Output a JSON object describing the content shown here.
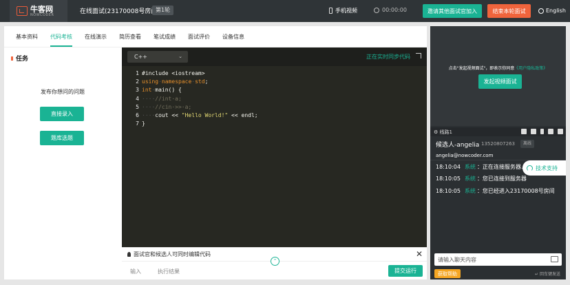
{
  "app": {
    "logo_cn": "牛客网",
    "logo_en": "NOWCODER",
    "room_title": "在线面试(23170008号房间)",
    "round": "第1轮"
  },
  "header": {
    "phone_video": "手机视频",
    "timer": "00:00:00",
    "invite_button": "邀请其他面试官加入",
    "end_button": "结束本轮面试",
    "language": "English"
  },
  "tabs": [
    {
      "label": "基本资料"
    },
    {
      "label": "代码考核",
      "active": true
    },
    {
      "label": "在线演示"
    },
    {
      "label": "简历查看"
    },
    {
      "label": "笔试成绩"
    },
    {
      "label": "面试评价"
    },
    {
      "label": "设备信息"
    }
  ],
  "task": {
    "title": "任务",
    "description": "发布你想问的问题",
    "direct_button": "直接录入",
    "bank_button": "题库选题"
  },
  "editor": {
    "language": "C++",
    "sync_status": "正在实时同步代码",
    "footer_hint": "面试官和候选人可同时编辑代码",
    "tab_input": "输入",
    "tab_result": "执行结果",
    "submit_button": "提交运行",
    "lines": [
      {
        "n": "1",
        "parts": [
          {
            "c": "c-white",
            "t": "#include <iostream>"
          }
        ]
      },
      {
        "n": "2",
        "parts": [
          {
            "c": "c-orange",
            "t": "using"
          },
          {
            "c": "c-dot",
            "t": "·"
          },
          {
            "c": "c-orange",
            "t": "namespace"
          },
          {
            "c": "c-dot",
            "t": "·"
          },
          {
            "c": "c-orange",
            "t": "std"
          },
          {
            "c": "c-white",
            "t": ";"
          }
        ]
      },
      {
        "n": "3",
        "parts": [
          {
            "c": "c-orange",
            "t": "int"
          },
          {
            "c": "c-dot",
            "t": "·"
          },
          {
            "c": "c-white",
            "t": "main() {"
          }
        ]
      },
      {
        "n": "4",
        "parts": [
          {
            "c": "c-dot",
            "t": "····"
          },
          {
            "c": "c-gray",
            "t": "//int·a;"
          }
        ]
      },
      {
        "n": "5",
        "parts": [
          {
            "c": "c-dot",
            "t": "····"
          },
          {
            "c": "c-gray",
            "t": "//cin·>>·a;"
          }
        ]
      },
      {
        "n": "6",
        "parts": [
          {
            "c": "c-dot",
            "t": "····"
          },
          {
            "c": "c-white",
            "t": "cout << "
          },
          {
            "c": "c-yellow",
            "t": "\"Hello World!\""
          },
          {
            "c": "c-white",
            "t": " << endl;"
          }
        ]
      },
      {
        "n": "7",
        "parts": [
          {
            "c": "c-white",
            "t": "}"
          }
        ]
      }
    ]
  },
  "video": {
    "hint_prefix": "点击\"发起视频面试\"，即表示你同意",
    "hint_link": "《用户隐私政策》",
    "start_button": "发起视频面试",
    "line_label": "线路1"
  },
  "candidate": {
    "name": "候选人-angelia",
    "phone": "13520807263",
    "status": "离线",
    "email": "angelia@nowcoder.com"
  },
  "chat": {
    "messages": [
      {
        "time": "18:10:04",
        "sender": "系统",
        "text": "：正在连接服务器..."
      },
      {
        "time": "18:10:05",
        "sender": "系统",
        "text": "：您已连接到服务器"
      },
      {
        "time": "18:10:05",
        "sender": "系统",
        "text": "：您已经进入23170008号房间"
      }
    ],
    "support": "技术支持",
    "placeholder": "请输入聊天内容",
    "help_button": "获取帮助",
    "enter_hint": "回车键发送"
  },
  "colors": {
    "accent": "#1ab394",
    "danger": "#f0643c",
    "topbar": "#2f3437",
    "editor_bg": "#272822"
  }
}
